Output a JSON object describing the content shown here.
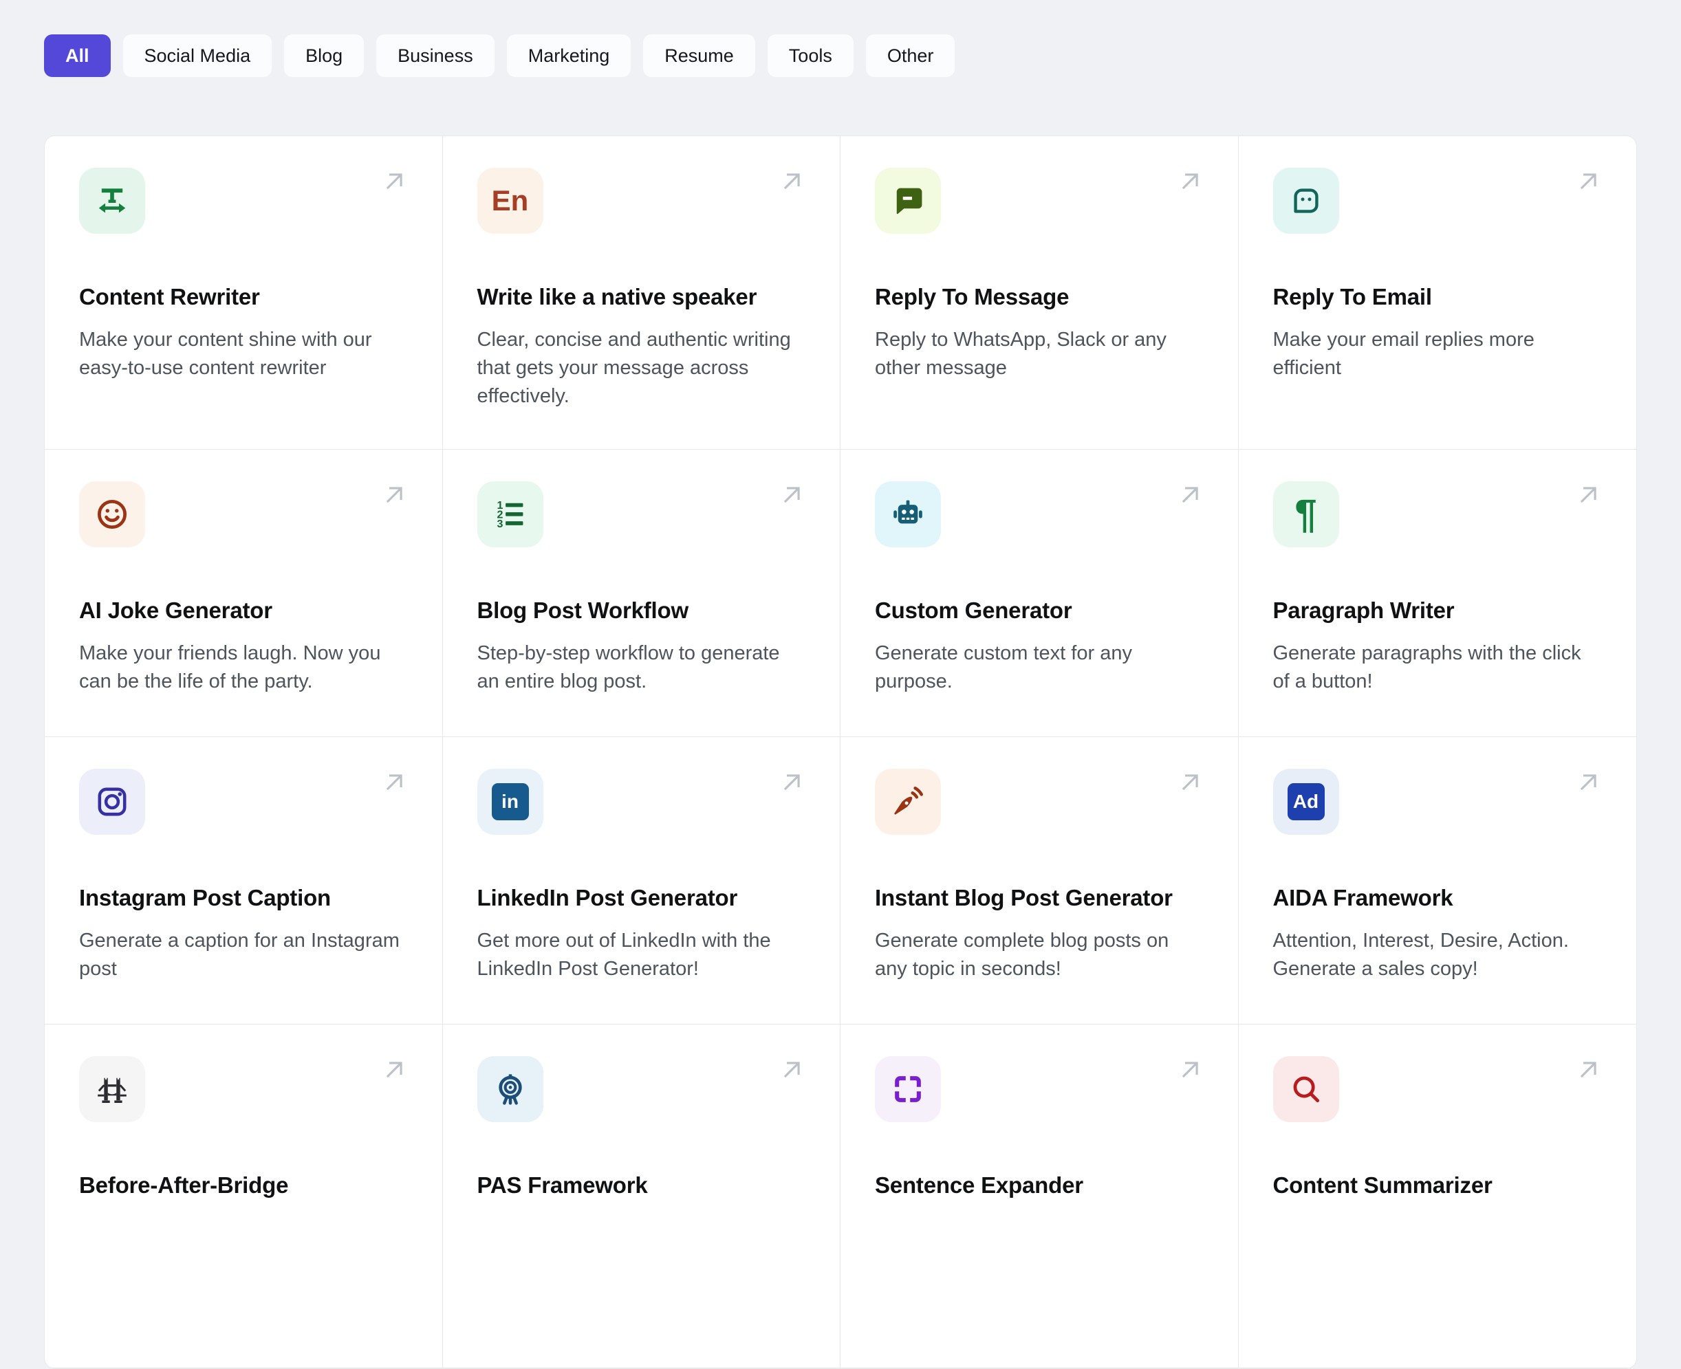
{
  "page": {
    "background": "#EFF1F4"
  },
  "filters": {
    "active": "All",
    "active_color": "#5348D8",
    "items": [
      {
        "label": "All"
      },
      {
        "label": "Social Media"
      },
      {
        "label": "Blog"
      },
      {
        "label": "Business"
      },
      {
        "label": "Marketing"
      },
      {
        "label": "Resume"
      },
      {
        "label": "Tools"
      },
      {
        "label": "Other"
      }
    ]
  },
  "cards": [
    {
      "title": "Content Rewriter",
      "description": "Make your content shine with our easy-to-use content rewriter",
      "icon": {
        "name": "text-width-icon",
        "color": "#15803D",
        "bg": "#E4F6EB"
      }
    },
    {
      "title": "Write like a native speaker",
      "description": "Clear, concise and authentic writing that gets your message across effectively.",
      "icon": {
        "name": "english-text-icon",
        "glyph": "En",
        "color": "#A63E26",
        "bg": "#FDF2E7"
      }
    },
    {
      "title": "Reply To Message",
      "description": "Reply to WhatsApp, Slack or any other message",
      "icon": {
        "name": "chat-bubble-minus-icon",
        "color": "#3F6212",
        "bg": "#F2FADF"
      }
    },
    {
      "title": "Reply To Email",
      "description": "Make your email replies more efficient",
      "icon": {
        "name": "chat-bubble-dots-icon",
        "color": "#11655B",
        "bg": "#E1F5F2"
      }
    },
    {
      "title": "AI Joke Generator",
      "description": "Make your friends laugh. Now you can be the life of the party.",
      "icon": {
        "name": "smiley-face-icon",
        "color": "#9A3412",
        "bg": "#FDF2EA"
      }
    },
    {
      "title": "Blog Post Workflow",
      "description": "Step-by-step workflow to generate an entire blog post.",
      "icon": {
        "name": "numbered-list-icon",
        "color": "#166534",
        "bg": "#E7F8EE"
      }
    },
    {
      "title": "Custom Generator",
      "description": "Generate custom text for any purpose.",
      "icon": {
        "name": "robot-icon",
        "color": "#155E75",
        "bg": "#E1F6FA"
      }
    },
    {
      "title": "Paragraph Writer",
      "description": "Generate paragraphs with the click of a button!",
      "icon": {
        "name": "pilcrow-icon",
        "glyph": "¶",
        "color": "#15803D",
        "bg": "#E9F8EF"
      }
    },
    {
      "title": "Instagram Post Caption",
      "description": "Generate a caption for an Instagram post",
      "icon": {
        "name": "instagram-icon",
        "color": "#3730A3",
        "bg": "#ECEEF9"
      }
    },
    {
      "title": "LinkedIn Post Generator",
      "description": "Get more out of LinkedIn with the LinkedIn Post Generator!",
      "icon": {
        "name": "linkedin-icon",
        "glyph": "in",
        "color": "#FFFFFF",
        "bg": "#EAF2F9",
        "badge_bg": "#175A8E"
      }
    },
    {
      "title": "Instant Blog Post Generator",
      "description": "Generate complete blog posts on any topic in seconds!",
      "icon": {
        "name": "pen-signal-icon",
        "color": "#9A3412",
        "bg": "#FDF1E7"
      }
    },
    {
      "title": "AIDA Framework",
      "description": "Attention, Interest, Desire, Action. Generate a sales copy!",
      "icon": {
        "name": "ad-badge-icon",
        "glyph": "Ad",
        "color": "#FFFFFF",
        "bg": "#E8EEF8",
        "badge_bg": "#1E40AF"
      }
    },
    {
      "title": "Before-After-Bridge",
      "description": "",
      "icon": {
        "name": "tower-bridge-icon",
        "color": "#2B2B30",
        "bg": "#F5F5F6"
      }
    },
    {
      "title": "PAS Framework",
      "description": "",
      "icon": {
        "name": "target-stand-icon",
        "color": "#1D4E78",
        "bg": "#E7F1F8"
      }
    },
    {
      "title": "Sentence Expander",
      "description": "",
      "icon": {
        "name": "expand-corners-icon",
        "color": "#7A1FD0",
        "bg": "#F5F0FA"
      }
    },
    {
      "title": "Content Summarizer",
      "description": "",
      "icon": {
        "name": "magnifier-icon",
        "color": "#B91C1C",
        "bg": "#FBE9E9"
      }
    }
  ]
}
